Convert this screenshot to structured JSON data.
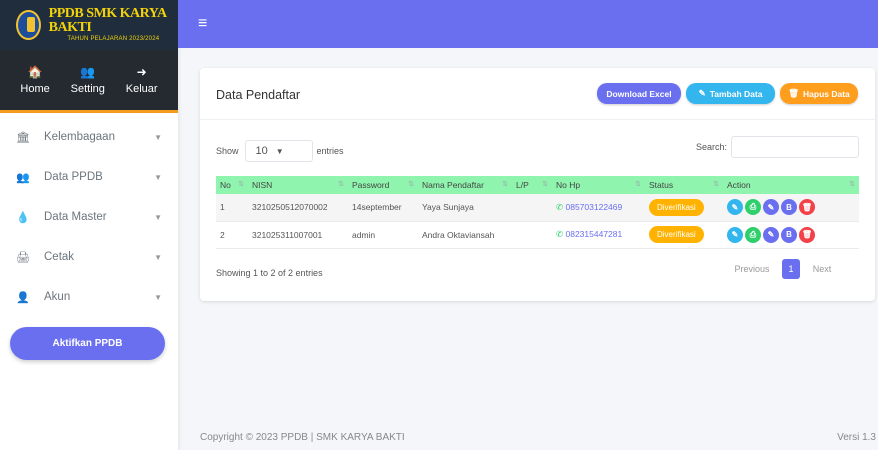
{
  "brand": {
    "title": "PPDB SMK KARYA BAKTI",
    "subtitle": "TAHUN PELAJARAN 2023/2024"
  },
  "user_panel": [
    {
      "icon": "home-icon",
      "glyph": "🏠",
      "label": "Home"
    },
    {
      "icon": "users-cog-icon",
      "glyph": "👥",
      "label": "Setting"
    },
    {
      "icon": "sign-out-icon",
      "glyph": "➜",
      "label": "Keluar"
    }
  ],
  "sidebar": {
    "items": [
      {
        "glyph": "🏛",
        "label": "Kelembagaan"
      },
      {
        "glyph": "👥",
        "label": "Data PPDB"
      },
      {
        "glyph": "💧",
        "label": "Data Master"
      },
      {
        "glyph": "🖨",
        "label": "Cetak"
      },
      {
        "glyph": "👤",
        "label": "Akun"
      }
    ],
    "activate_label": "Aktifkan PPDB"
  },
  "topbar": {
    "menu_glyph": "≡"
  },
  "card": {
    "title": "Data Pendaftar",
    "btn_excel": "Download Excel",
    "btn_tambah": "Tambah Data",
    "btn_hapus": "Hapus Data"
  },
  "table_controls": {
    "show_label": "Show",
    "entries_value": "10",
    "entries_label": "entries",
    "search_label": "Search:"
  },
  "table": {
    "headers": [
      "No",
      "NISN",
      "Password",
      "Nama Pendaftar",
      "L/P",
      "No Hp",
      "Status",
      "Action"
    ],
    "rows": [
      {
        "no": "1",
        "nisn": "3210250512070002",
        "password": "14september",
        "nama": "Yaya Sunjaya",
        "lp": "",
        "hp": "085703122469",
        "status": "Diverifikasi"
      },
      {
        "no": "2",
        "nisn": "321025311007001",
        "password": "admin",
        "nama": "Andra Oktaviansah",
        "lp": "",
        "hp": "082315447281",
        "status": "Diverifikasi"
      }
    ]
  },
  "pagination": {
    "info": "Showing 1 to 2 of 2 entries",
    "prev": "Previous",
    "page": "1",
    "next": "Next"
  },
  "footer": {
    "copyright": "Copyright © 2023 PPDB | SMK KARYA BAKTI",
    "version": "Versi 1.3"
  },
  "colors": {
    "accent": "#6a6ff0",
    "table_header": "#8ff5ae",
    "status": "#ffb300",
    "orange": "#ff9d1c",
    "cyan": "#33b6ee"
  }
}
